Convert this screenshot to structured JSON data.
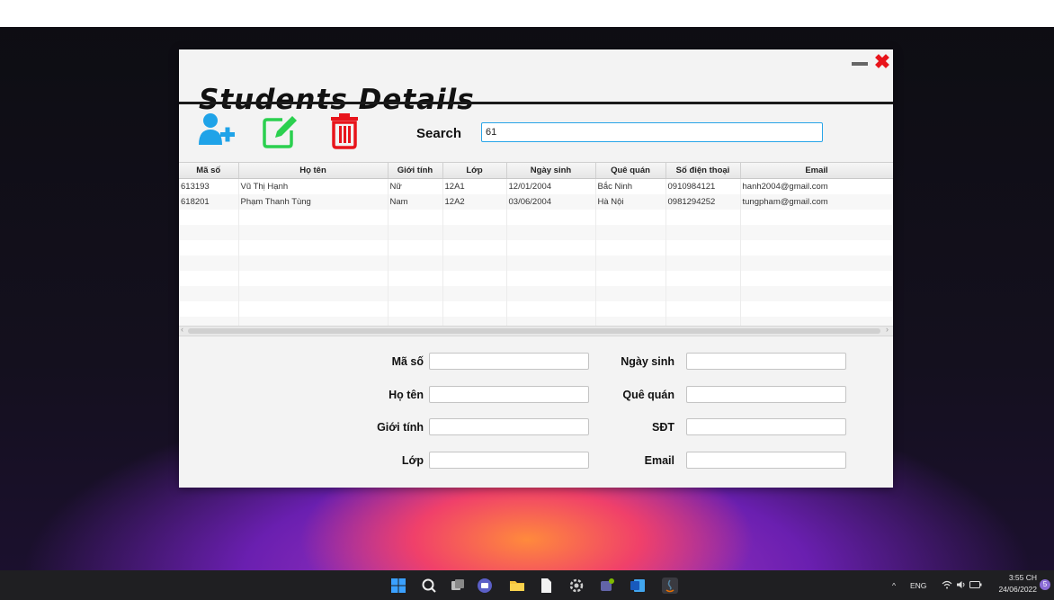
{
  "window": {
    "title": "Students Details",
    "minimize_label": "",
    "close_label": "✖"
  },
  "toolbar": {
    "add_icon": "add-user-icon",
    "edit_icon": "edit-icon",
    "delete_icon": "trash-icon",
    "search_label": "Search",
    "search_value": "61"
  },
  "table": {
    "columns": [
      "Mã số",
      "Họ tên",
      "Giới tính",
      "Lớp",
      "Ngày sinh",
      "Quê quán",
      "Số điện thoại",
      "Email"
    ],
    "rows": [
      [
        "613193",
        "Vũ Thị Hạnh",
        "Nữ",
        "12A1",
        "12/01/2004",
        "Bắc Ninh",
        "0910984121",
        "hanh2004@gmail.com"
      ],
      [
        "618201",
        "Phạm Thanh Tùng",
        "Nam",
        "12A2",
        "03/06/2004",
        "Hà Nội",
        "0981294252",
        "tungpham@gmail.com"
      ]
    ]
  },
  "form": {
    "ma_so": "Mã số",
    "ho_ten": "Họ tên",
    "gioi_tinh": "Giới tính",
    "lop": "Lớp",
    "ngay_sinh": "Ngày sinh",
    "que_quan": "Quê quán",
    "sdt": "SĐT",
    "email": "Email"
  },
  "taskbar": {
    "tray_lang": "ENG",
    "time": "3:55 CH",
    "date": "24/06/2022",
    "notification_count": "5"
  },
  "colors": {
    "add_icon": "#1fa3e8",
    "edit_icon": "#2bd04f",
    "delete_icon": "#e8141b",
    "close": "#e8141b",
    "search_border": "#29a5e8"
  }
}
